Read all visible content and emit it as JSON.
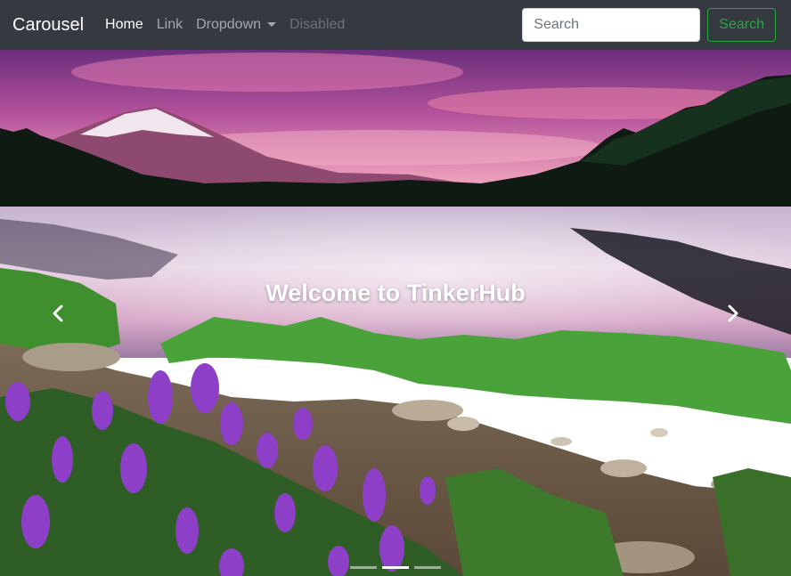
{
  "navbar": {
    "brand": "Carousel",
    "links": [
      {
        "label": "Home",
        "state": "active"
      },
      {
        "label": "Link",
        "state": "normal"
      },
      {
        "label": "Dropdown",
        "state": "dropdown"
      },
      {
        "label": "Disabled",
        "state": "disabled"
      }
    ],
    "search": {
      "placeholder": "Search",
      "button_label": "Search"
    }
  },
  "carousel": {
    "caption": "Welcome to TinkerHub",
    "prev_icon": "chevron-left-icon",
    "next_icon": "chevron-right-icon",
    "indicators": {
      "count": 3,
      "active_index": 1
    }
  },
  "colors": {
    "navbar_bg": "#343a40",
    "success": "#28a745",
    "white": "#ffffff"
  }
}
